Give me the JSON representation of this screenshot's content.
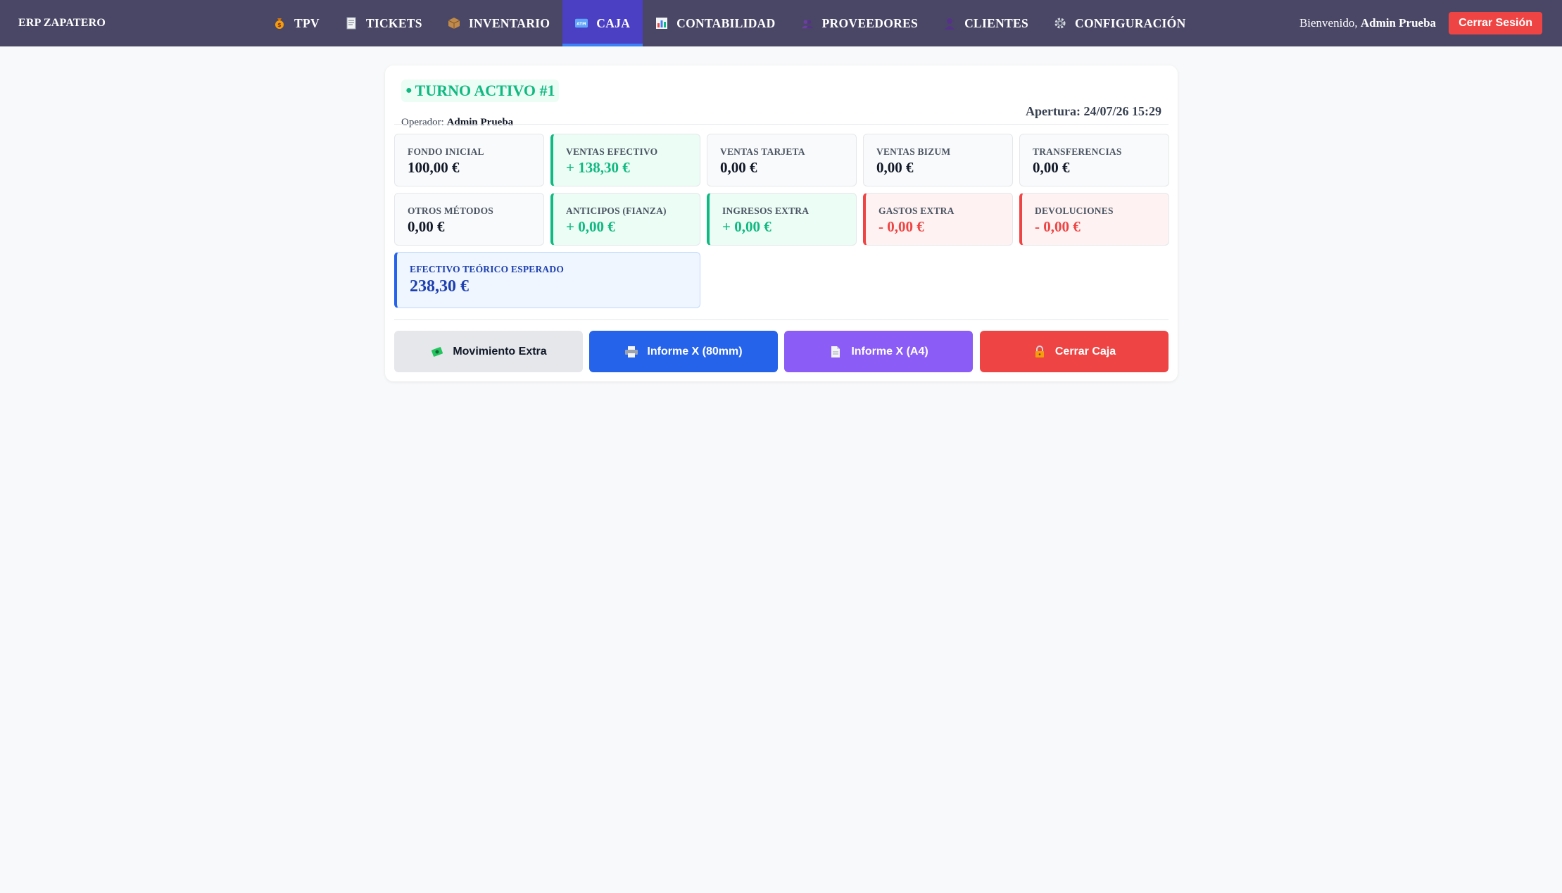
{
  "navbar": {
    "brand": "ERP ZAPATERO",
    "items": [
      {
        "label": "TPV",
        "icon": "money-bag-icon",
        "active": false
      },
      {
        "label": "TICKETS",
        "icon": "receipt-icon",
        "active": false
      },
      {
        "label": "INVENTARIO",
        "icon": "package-icon",
        "active": false
      },
      {
        "label": "CAJA",
        "icon": "atm-icon",
        "active": true
      },
      {
        "label": "CONTABILIDAD",
        "icon": "bar-chart-icon",
        "active": false
      },
      {
        "label": "PROVEEDORES",
        "icon": "people-icon",
        "active": false
      },
      {
        "label": "CLIENTES",
        "icon": "person-icon",
        "active": false
      },
      {
        "label": "CONFIGURACIÓN",
        "icon": "gear-icon",
        "active": false
      }
    ],
    "welcome_prefix": "Bienvenido,",
    "user_name": "Admin Prueba",
    "logout_label": "Cerrar Sesión"
  },
  "shift": {
    "badge_dot": "●",
    "title": "TURNO ACTIVO #1",
    "operator_label": "Operador:",
    "operator_name": "Admin Prueba",
    "apertura": "Apertura: 24/07/26 15:29"
  },
  "stats": {
    "row1": [
      {
        "label": "FONDO INICIAL",
        "value": "100,00 €",
        "tone": "neutral"
      },
      {
        "label": "VENTAS EFECTIVO",
        "value": "+ 138,30 €",
        "tone": "green"
      },
      {
        "label": "VENTAS TARJETA",
        "value": "0,00 €",
        "tone": "neutral"
      },
      {
        "label": "VENTAS BIZUM",
        "value": "0,00 €",
        "tone": "neutral"
      },
      {
        "label": "TRANSFERENCIAS",
        "value": "0,00 €",
        "tone": "neutral"
      }
    ],
    "row2": [
      {
        "label": "OTROS MÉTODOS",
        "value": "0,00 €",
        "tone": "neutral"
      },
      {
        "label": "ANTICIPOS (FIANZA)",
        "value": "+ 0,00 €",
        "tone": "green"
      },
      {
        "label": "INGRESOS EXTRA",
        "value": "+ 0,00 €",
        "tone": "green"
      },
      {
        "label": "GASTOS EXTRA",
        "value": "- 0,00 €",
        "tone": "red"
      },
      {
        "label": "DEVOLUCIONES",
        "value": "- 0,00 €",
        "tone": "red"
      }
    ],
    "expected": {
      "label": "EFECTIVO TEÓRICO ESPERADO",
      "value": "238,30 €"
    }
  },
  "actions": {
    "extra_movement": "Movimiento Extra",
    "report_80mm": "Informe X (80mm)",
    "report_a4": "Informe X (A4)",
    "close_register": "Cerrar Caja"
  },
  "colors": {
    "navbar_bg": "#4a4766",
    "nav_active_bg": "#4b3fc4",
    "success": "#10b981",
    "danger": "#ef4444",
    "primary": "#2563eb",
    "purple": "#8b5cf6"
  }
}
